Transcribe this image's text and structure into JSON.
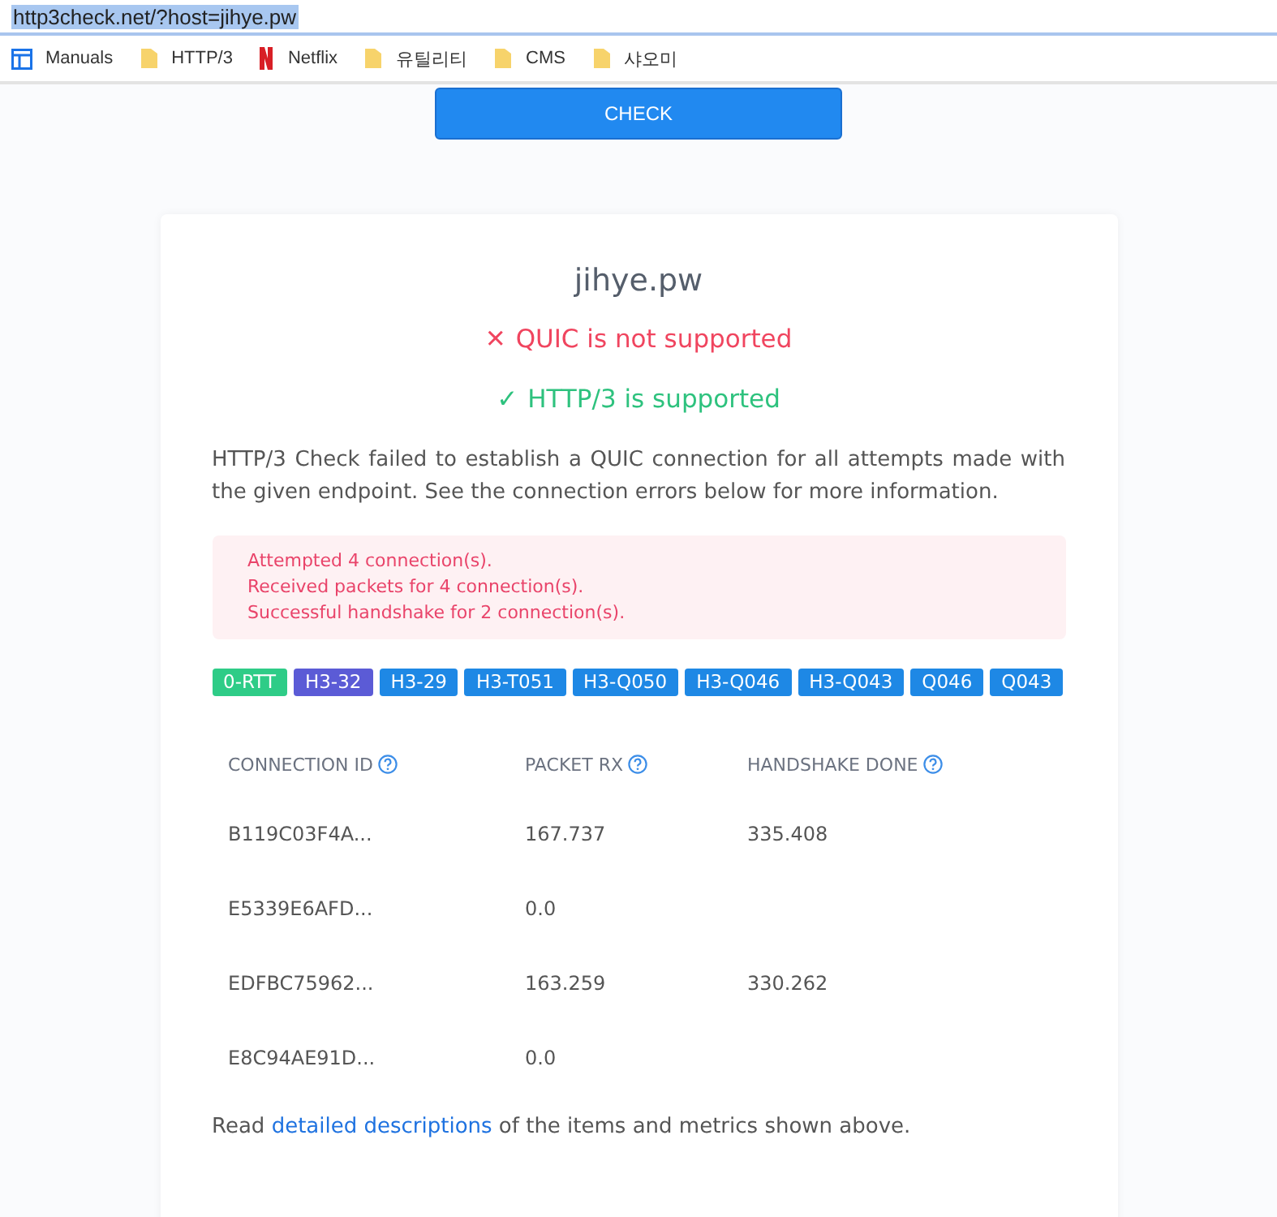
{
  "address_bar": {
    "url": "http3check.net/?host=jihye.pw",
    "selected": true
  },
  "bookmarks": [
    {
      "label": "Manuals",
      "kind": "app"
    },
    {
      "label": "HTTP/3",
      "kind": "folder"
    },
    {
      "label": "Netflix",
      "kind": "netflix"
    },
    {
      "label": "유틸리티",
      "kind": "folder"
    },
    {
      "label": "CMS",
      "kind": "folder"
    },
    {
      "label": "샤오미",
      "kind": "folder"
    }
  ],
  "check_button": "CHECK",
  "result": {
    "host": "jihye.pw",
    "status": [
      {
        "kind": "fail",
        "icon": "✕",
        "text": "QUIC is not supported"
      },
      {
        "kind": "ok",
        "icon": "✓",
        "text": "HTTP/3 is supported"
      }
    ],
    "description": "HTTP/3 Check failed to establish a QUIC connection for all attempts made with the given endpoint. See the connection errors below for more information.",
    "alert": [
      "Attempted 4 connection(s).",
      "Received packets for 4 connection(s).",
      "Successful handshake for 2 connection(s)."
    ],
    "tags": [
      {
        "label": "0-RTT",
        "color": "#2ecc87"
      },
      {
        "label": "H3-32",
        "color": "#5b5bd6"
      },
      {
        "label": "H3-29",
        "color": "#1e88e5"
      },
      {
        "label": "H3-T051",
        "color": "#1e88e5"
      },
      {
        "label": "H3-Q050",
        "color": "#1e88e5"
      },
      {
        "label": "H3-Q046",
        "color": "#1e88e5"
      },
      {
        "label": "H3-Q043",
        "color": "#1e88e5"
      },
      {
        "label": "Q046",
        "color": "#1e88e5"
      },
      {
        "label": "Q043",
        "color": "#1e88e5"
      }
    ],
    "table": {
      "columns": [
        "CONNECTION ID",
        "PACKET RX",
        "HANDSHAKE DONE"
      ],
      "rows": [
        [
          "B119C03F4A...",
          "167.737",
          "335.408"
        ],
        [
          "E5339E6AFD...",
          "0.0",
          ""
        ],
        [
          "EDFBC75962...",
          "163.259",
          "330.262"
        ],
        [
          "E8C94AE91D...",
          "0.0",
          ""
        ]
      ]
    },
    "footer": {
      "before": "Read ",
      "link": "detailed descriptions",
      "after": " of the items and metrics shown above."
    }
  }
}
